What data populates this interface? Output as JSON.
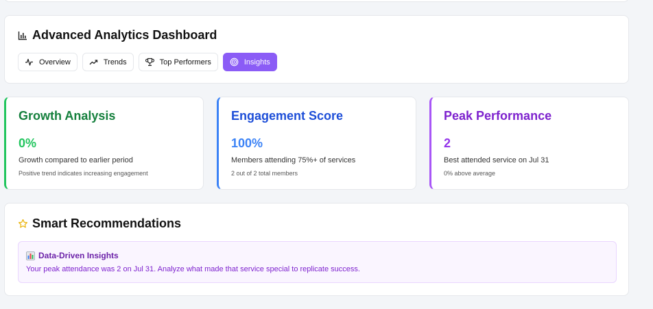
{
  "dashboard": {
    "title": "Advanced Analytics Dashboard",
    "title_icon": "bar-chart-icon",
    "tabs": [
      {
        "label": "Overview",
        "icon": "activity-icon",
        "active": false
      },
      {
        "label": "Trends",
        "icon": "trending-up-icon",
        "active": false
      },
      {
        "label": "Top Performers",
        "icon": "trophy-icon",
        "active": false
      },
      {
        "label": "Insights",
        "icon": "target-icon",
        "active": true
      }
    ]
  },
  "metrics": {
    "growth": {
      "title": "Growth Analysis",
      "value": "0%",
      "description": "Growth compared to earlier period",
      "note": "Positive trend indicates increasing engagement",
      "color": "#22c55e"
    },
    "engagement": {
      "title": "Engagement Score",
      "value": "100%",
      "description": "Members attending 75%+ of services",
      "note": "2 out of 2 total members",
      "color": "#3b82f6"
    },
    "peak": {
      "title": "Peak Performance",
      "value": "2",
      "description": "Best attended service on Jul 31",
      "note": "0% above average",
      "color": "#a855f7"
    }
  },
  "recommendations": {
    "title": "Smart Recommendations",
    "title_icon": "star-icon",
    "insight": {
      "icon": "chart-emoji-icon",
      "heading": "Data-Driven Insights",
      "text": "Your peak attendance was 2 on Jul 31. Analyze what made that service special to replicate success."
    }
  },
  "colors": {
    "accent": "#8b5cf6",
    "background": "#f3f5f8"
  }
}
